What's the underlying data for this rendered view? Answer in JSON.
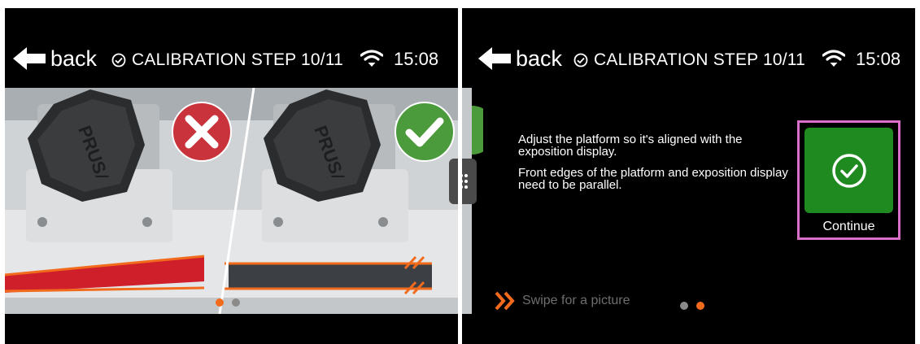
{
  "left_screen": {
    "back_label": "back",
    "title": "CALIBRATION STEP 10/11",
    "time": "15:08",
    "bad_example": "x-mark-icon",
    "good_example": "check-mark-icon",
    "knob_lettering": "PRUSA",
    "pager": {
      "active_index": 0,
      "total": 2
    }
  },
  "right_screen": {
    "back_label": "back",
    "title": "CALIBRATION STEP 10/11",
    "time": "15:08",
    "message_line1": "Adjust the platform so it's aligned with the exposition display.",
    "message_line2": "Front edges of the platform and exposition display need to be parallel.",
    "continue_label": "Continue",
    "swipe_hint": "Swipe for a picture",
    "pager": {
      "active_index": 1,
      "total": 2
    }
  },
  "colors": {
    "accent_orange": "#f26b1d",
    "continue_green": "#1f8a1f",
    "focus_border": "#d96fc7",
    "error_red": "#c9333b",
    "ok_green": "#4b9a3b",
    "swipe_text": "#6e6e6e"
  }
}
